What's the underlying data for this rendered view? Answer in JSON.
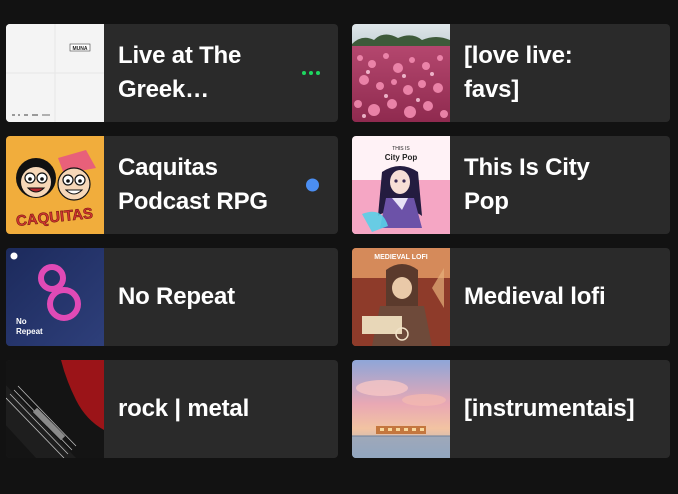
{
  "playlists": [
    {
      "title": "Live at The Greek Theatr…",
      "cover_icon": "muna-live-cover",
      "indicator": "playing-dots",
      "indicator_color": "#1ed760"
    },
    {
      "title": "[love live: favs]",
      "cover_icon": "pink-flower-field-cover"
    },
    {
      "title": "Caquitas Podcast RPG",
      "cover_icon": "caquitas-cartoon-cover",
      "indicator": "new-episode-dot",
      "indicator_color": "#4b8ef2",
      "cover_text": "CAQUITAS"
    },
    {
      "title": "This Is City Pop",
      "cover_icon": "city-pop-anime-cover",
      "cover_text_top": "THIS IS",
      "cover_text_main": "City Pop"
    },
    {
      "title": "No Repeat",
      "cover_icon": "no-repeat-spotify-cover",
      "cover_text": "No Repeat"
    },
    {
      "title": "Medieval lofi",
      "cover_icon": "medieval-lofi-cover",
      "cover_text": "MEDIEVAL LOFI"
    },
    {
      "title": "rock | metal",
      "cover_icon": "guitar-cover"
    },
    {
      "title": "[instrumentais]",
      "cover_icon": "sunset-train-cover"
    }
  ],
  "colors": {
    "background": "#121212",
    "card": "#2a2a2a",
    "accent_green": "#1ed760",
    "accent_blue": "#4b8ef2"
  },
  "cover_labels": {
    "muna": "MUNA"
  }
}
